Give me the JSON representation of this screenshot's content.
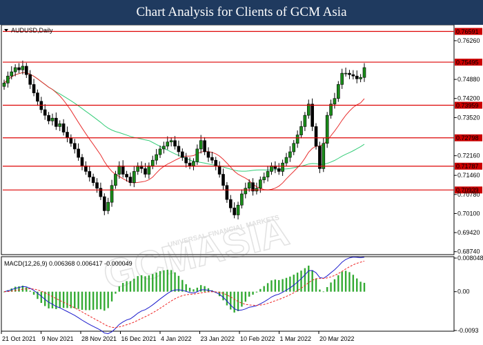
{
  "header": {
    "title": "Chart Analysis for Clients of GCM Asia"
  },
  "watermark": {
    "text": "GCMASIA",
    "subtext": "UNIVERSAL FINANCIAL MARKETS"
  },
  "colors": {
    "header_bg": "#1f3a5f",
    "level_line": "#dd0000",
    "ma_fast": "#e83030",
    "ma_slow": "#33cc77",
    "candle_bull": "#1a8c1a",
    "macd_line": "#1a1acc",
    "signal_line": "#ee2222",
    "histogram": "#33aa33"
  },
  "chart_data": [
    {
      "type": "candlestick",
      "title": "AUDUSD,Daily",
      "ylim": [
        0.6866,
        0.768
      ],
      "y_ticks": [
        "0.76260",
        "0.74880",
        "0.74200",
        "0.73520",
        "0.72160",
        "0.71460",
        "0.70780",
        "0.70100",
        "0.69420",
        "0.68740"
      ],
      "levels": [
        "0.76591",
        "0.75495",
        "0.73959",
        "0.72798",
        "0.71787",
        "0.70939"
      ],
      "x_labels": [
        "21 Oct 2021",
        "9 Nov 2021",
        "28 Nov 2021",
        "16 Dec 2021",
        "4 Jan 2022",
        "23 Jan 2022",
        "10 Feb 2022",
        "1 Mar 2022",
        "20 Mar 2022"
      ],
      "closes": [
        0.7475,
        0.75,
        0.7515,
        0.753,
        0.7522,
        0.7535,
        0.7505,
        0.747,
        0.744,
        0.741,
        0.738,
        0.736,
        0.734,
        0.735,
        0.732,
        0.733,
        0.73,
        0.728,
        0.726,
        0.724,
        0.721,
        0.718,
        0.716,
        0.714,
        0.712,
        0.71,
        0.707,
        0.702,
        0.705,
        0.711,
        0.715,
        0.718,
        0.715,
        0.714,
        0.712,
        0.716,
        0.718,
        0.717,
        0.715,
        0.718,
        0.72,
        0.722,
        0.724,
        0.725,
        0.7265,
        0.727,
        0.725,
        0.723,
        0.721,
        0.719,
        0.718,
        0.7195,
        0.724,
        0.727,
        0.723,
        0.721,
        0.72,
        0.718,
        0.715,
        0.711,
        0.706,
        0.703,
        0.7005,
        0.704,
        0.708,
        0.71,
        0.712,
        0.709,
        0.71,
        0.713,
        0.714,
        0.716,
        0.718,
        0.717,
        0.716,
        0.719,
        0.721,
        0.723,
        0.726,
        0.729,
        0.732,
        0.736,
        0.74,
        0.732,
        0.725,
        0.717,
        0.726,
        0.736,
        0.74,
        0.742,
        0.747,
        0.751,
        0.751,
        0.7505,
        0.75,
        0.749,
        0.7495,
        0.753
      ]
    },
    {
      "type": "line",
      "title": "MACD(12,26,9) 0.006368 0.006417 -0.000049",
      "ylim": [
        -0.0093,
        0.008048
      ],
      "y_ticks": [
        "0.008048",
        "0.00",
        "-0.0093"
      ],
      "series": []
    }
  ]
}
